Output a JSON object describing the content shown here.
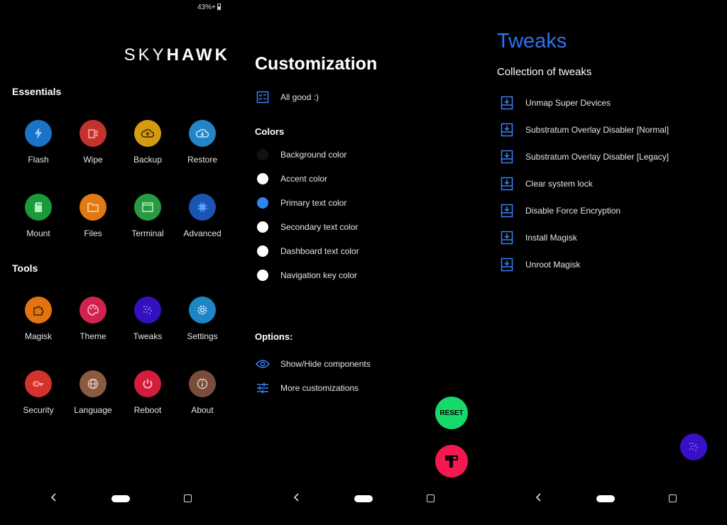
{
  "status_bar": {
    "battery": "43%+"
  },
  "brand": {
    "part1": "SKY",
    "part2": "HAWK"
  },
  "essentials": {
    "title": "Essentials",
    "items": [
      {
        "label": "Flash",
        "icon": "flash-icon",
        "color": "#1a72c9"
      },
      {
        "label": "Wipe",
        "icon": "wipe-icon",
        "color": "#c3332e"
      },
      {
        "label": "Backup",
        "icon": "cloud-upload-icon",
        "color": "#d49a12"
      },
      {
        "label": "Restore",
        "icon": "cloud-download-icon",
        "color": "#2385c8"
      },
      {
        "label": "Mount",
        "icon": "sd-card-icon",
        "color": "#1a9a3a"
      },
      {
        "label": "Files",
        "icon": "folder-icon",
        "color": "#e07a15"
      },
      {
        "label": "Terminal",
        "icon": "terminal-icon",
        "color": "#2a9a41"
      },
      {
        "label": "Advanced",
        "icon": "chip-icon",
        "color": "#1a55b3"
      }
    ]
  },
  "tools": {
    "title": "Tools",
    "items": [
      {
        "label": "Magisk",
        "icon": "puzzle-icon",
        "color": "#e2730f"
      },
      {
        "label": "Theme",
        "icon": "palette-icon",
        "color": "#d0244e"
      },
      {
        "label": "Tweaks",
        "icon": "tweaks-icon",
        "color": "#3411bf"
      },
      {
        "label": "Settings",
        "icon": "gear-icon",
        "color": "#1d86c4"
      },
      {
        "label": "Security",
        "icon": "key-icon",
        "color": "#d3322d"
      },
      {
        "label": "Language",
        "icon": "globe-icon",
        "color": "#8a5a43"
      },
      {
        "label": "Reboot",
        "icon": "power-icon",
        "color": "#d31d3b"
      },
      {
        "label": "About",
        "icon": "info-icon",
        "color": "#7a4d3b"
      }
    ]
  },
  "customization": {
    "title": "Customization",
    "status": "All good :)",
    "colors_title": "Colors",
    "colors": [
      {
        "label": "Background color",
        "swatch": "#111111"
      },
      {
        "label": "Accent color",
        "swatch": "#ffffff"
      },
      {
        "label": "Primary text color",
        "swatch": "#2d86f0"
      },
      {
        "label": "Secondary text color",
        "swatch": "#ffffff"
      },
      {
        "label": "Dashboard text color",
        "swatch": "#ffffff"
      },
      {
        "label": "Navigation key color",
        "swatch": "#ffffff"
      }
    ],
    "options_title": "Options:",
    "options": [
      {
        "label": "Show/Hide components",
        "icon": "eye-icon"
      },
      {
        "label": "More customizations",
        "icon": "sliders-icon"
      }
    ],
    "reset_label": "RESET"
  },
  "tweaks": {
    "title": "Tweaks",
    "subtitle": "Collection of tweaks",
    "items": [
      "Unmap Super Devices",
      "Substratum Overlay Disabler [Normal]",
      "Substratum Overlay Disabler [Legacy]",
      "Clear system lock",
      "Disable Force Encryption",
      "Install Magisk",
      "Unroot Magisk"
    ]
  },
  "accent_color": "#2f73f4"
}
